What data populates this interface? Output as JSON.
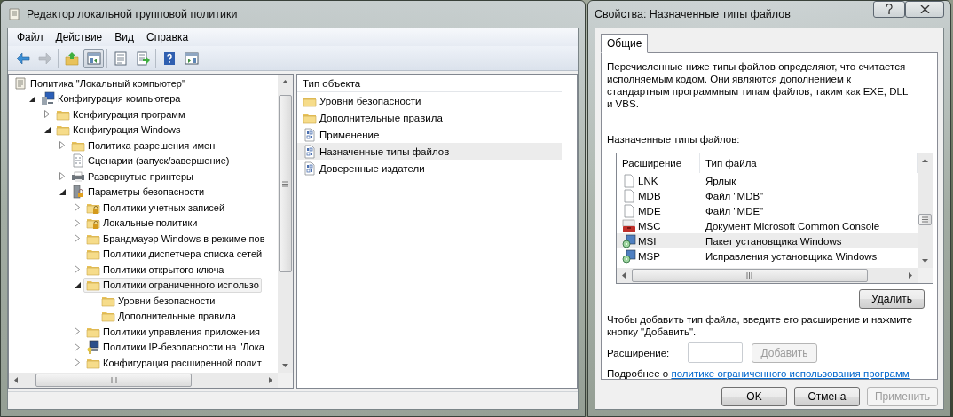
{
  "main_window": {
    "title": "Редактор локальной групповой политики",
    "menu": [
      "Файл",
      "Действие",
      "Вид",
      "Справка"
    ],
    "toolbar_groups": [
      [
        {
          "kind": "back",
          "disabled": false,
          "pressed": false
        },
        {
          "kind": "forward",
          "disabled": true,
          "pressed": false
        }
      ],
      [
        {
          "kind": "up",
          "disabled": false,
          "pressed": false
        },
        {
          "kind": "tree",
          "disabled": false,
          "pressed": true
        }
      ],
      [
        {
          "kind": "properties",
          "disabled": false,
          "pressed": false
        },
        {
          "kind": "export",
          "disabled": false,
          "pressed": false
        }
      ],
      [
        {
          "kind": "help",
          "disabled": false,
          "pressed": false
        },
        {
          "kind": "view",
          "disabled": false,
          "pressed": false
        }
      ]
    ],
    "tree": {
      "items": [
        {
          "label": "Политика \"Локальный компьютер\"",
          "kind": "policy",
          "selected": false,
          "children": [
            {
              "label": "Конфигурация компьютера",
              "kind": "computer",
              "expanded": true,
              "selected": false,
              "children": [
                {
                  "label": "Конфигурация программ",
                  "kind": "folder",
                  "expanded": false,
                  "selected": false
                },
                {
                  "label": "Конфигурация Windows",
                  "kind": "folder",
                  "expanded": true,
                  "selected": false,
                  "children": [
                    {
                      "label": "Политика разрешения имен",
                      "kind": "folder",
                      "expanded": false,
                      "selected": false
                    },
                    {
                      "label": "Сценарии (запуск/завершение)",
                      "kind": "script",
                      "selected": false
                    },
                    {
                      "label": "Развернутые принтеры",
                      "kind": "printer",
                      "expanded": false,
                      "selected": false
                    },
                    {
                      "label": "Параметры безопасности",
                      "kind": "security",
                      "expanded": true,
                      "selected": false,
                      "children": [
                        {
                          "label": "Политики учетных записей",
                          "kind": "folder-lock",
                          "expanded": false,
                          "selected": false
                        },
                        {
                          "label": "Локальные политики",
                          "kind": "folder-lock",
                          "expanded": false,
                          "selected": false
                        },
                        {
                          "label": "Брандмауэр Windows в режиме пов",
                          "kind": "folder",
                          "expanded": false,
                          "selected": false
                        },
                        {
                          "label": "Политики диспетчера списка сетей",
                          "kind": "folder",
                          "selected": false
                        },
                        {
                          "label": "Политики открытого ключа",
                          "kind": "folder",
                          "expanded": false,
                          "selected": false
                        },
                        {
                          "label": "Политики ограниченного использо",
                          "kind": "folder",
                          "expanded": true,
                          "selected": true,
                          "children": [
                            {
                              "label": "Уровни безопасности",
                              "kind": "folder",
                              "selected": false
                            },
                            {
                              "label": "Дополнительные правила",
                              "kind": "folder",
                              "selected": false
                            }
                          ]
                        },
                        {
                          "label": "Политики управления приложения",
                          "kind": "folder",
                          "expanded": false,
                          "selected": false
                        },
                        {
                          "label": "Политики IP-безопасности на \"Лока",
                          "kind": "ip",
                          "expanded": false,
                          "selected": false
                        },
                        {
                          "label": "Конфигурация расширенной полит",
                          "kind": "folder",
                          "expanded": false,
                          "selected": false
                        }
                      ]
                    }
                  ]
                }
              ]
            }
          ]
        }
      ]
    },
    "list": {
      "column": "Тип объекта",
      "items": [
        {
          "label": "Уровни безопасности",
          "kind": "folder",
          "selected": false
        },
        {
          "label": "Дополнительные правила",
          "kind": "folder",
          "selected": false
        },
        {
          "label": "Применение",
          "kind": "binary",
          "selected": false
        },
        {
          "label": "Назначенные типы файлов",
          "kind": "binary",
          "selected": true
        },
        {
          "label": "Доверенные издатели",
          "kind": "binary",
          "selected": false
        }
      ]
    }
  },
  "dialog": {
    "title": "Свойства: Назначенные типы файлов",
    "tabs": [
      {
        "label": "Общие",
        "selected": true
      }
    ],
    "description": "Перечисленные ниже типы файлов определяют, что считается исполняемым кодом. Они являются дополнением к стандартным программным типам файлов, таким как EXE, DLL и VBS.",
    "list_label": "Назначенные типы файлов:",
    "columns": [
      "Расширение",
      "Тип файла"
    ],
    "rows": [
      {
        "extension": "LNK",
        "type": "Ярлык",
        "kind": "file",
        "selected": false
      },
      {
        "extension": "MDB",
        "type": "Файл \"MDB\"",
        "kind": "file",
        "selected": false
      },
      {
        "extension": "MDE",
        "type": "Файл \"MDE\"",
        "kind": "file",
        "selected": false
      },
      {
        "extension": "MSC",
        "type": "Документ Microsoft Common Console",
        "kind": "console",
        "selected": false
      },
      {
        "extension": "MSI",
        "type": "Пакет установщика Windows",
        "kind": "installer",
        "selected": true
      },
      {
        "extension": "MSP",
        "type": "Исправления установщика Windows",
        "kind": "installer",
        "selected": false
      }
    ],
    "remove_button": "Удалить",
    "hint": "Чтобы добавить тип файла, введите его расширение и нажмите кнопку \"Добавить\".",
    "field_label": "Расширение:",
    "add_button": {
      "label": "Добавить",
      "disabled": true
    },
    "more_text": "Подробнее о",
    "more_link": "политике ограниченного использования программ",
    "buttons": [
      {
        "label": "OK",
        "disabled": false
      },
      {
        "label": "Отмена",
        "disabled": false
      },
      {
        "label": "Применить",
        "disabled": true
      }
    ]
  }
}
